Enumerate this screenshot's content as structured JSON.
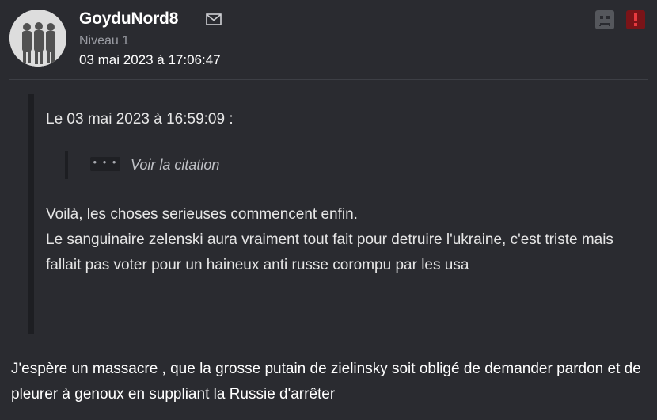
{
  "author": {
    "username": "GoyduNord8",
    "level": "Niveau 1",
    "date": "03 mai 2023 à 17:06:47"
  },
  "icons": {
    "avatar": "avatar-image",
    "message": "mail-icon",
    "reaction": "sad-face-icon",
    "report": "exclamation-icon"
  },
  "colors": {
    "background": "#2a2b30",
    "quote_bar": "#1d1e22",
    "report_button": "#7a1418",
    "reaction_button": "#55575c"
  },
  "quote": {
    "header": "Le 03 mai 2023 à 16:59:09 :",
    "nested": {
      "expand_label": "• • •",
      "label": "Voir la citation"
    },
    "lines": [
      "Voilà, les choses serieuses commencent enfin.",
      "Le sanguinaire zelenski aura vraiment tout fait pour detruire l'ukraine, c'est triste mais fallait pas voter pour un haineux anti russe corompu par les usa"
    ]
  },
  "message": {
    "text": "J'espère un massacre , que la grosse putain de zielinsky soit obligé de demander pardon et de pleurer à genoux en suppliant la Russie d'arrêter"
  }
}
